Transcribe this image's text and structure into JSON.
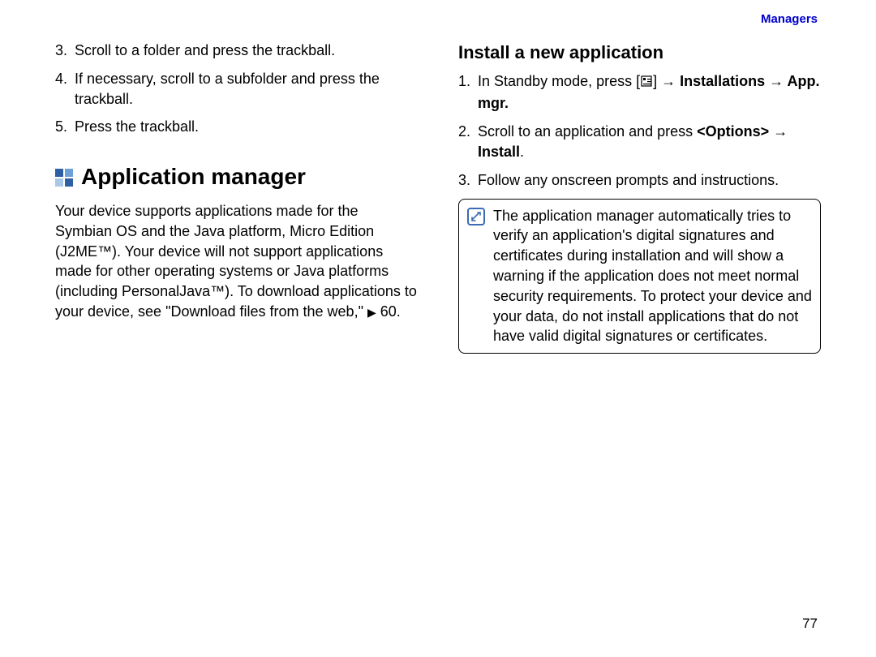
{
  "header": {
    "label": "Managers"
  },
  "page_number": "77",
  "left": {
    "steps_cont": [
      {
        "n": "3.",
        "t": "Scroll to a folder and press the trackball."
      },
      {
        "n": "4.",
        "t": "If necessary, scroll to a subfolder and press the trackball."
      },
      {
        "n": "5.",
        "t": "Press the trackball."
      }
    ],
    "section_title": "Application manager",
    "para_a": "Your device supports applications made for the Symbian OS and the Java platform, Micro Edition (J2ME™). Your device will not support applications made for other operating systems or Java platforms (including PersonalJava™). To download applications to your device, see \"Download files from the web,\" ",
    "para_a_ref": "60."
  },
  "right": {
    "sub_heading": "Install a new application",
    "step1_a": "In Standby mode, press [",
    "step1_b": "] ",
    "step1_bold": "Installations → App. mgr.",
    "step2_a": "Scroll to an application and press ",
    "step2_bold": "<Options> → Install",
    "step2_end": ".",
    "step3": "Follow any onscreen prompts and instructions.",
    "note": "The application manager automatically tries to verify an application's digital signatures and certificates during installation and will show a warning if the application does not meet normal security requirements. To protect your device and your data, do not install applications that do not have valid digital signatures or certificates."
  }
}
